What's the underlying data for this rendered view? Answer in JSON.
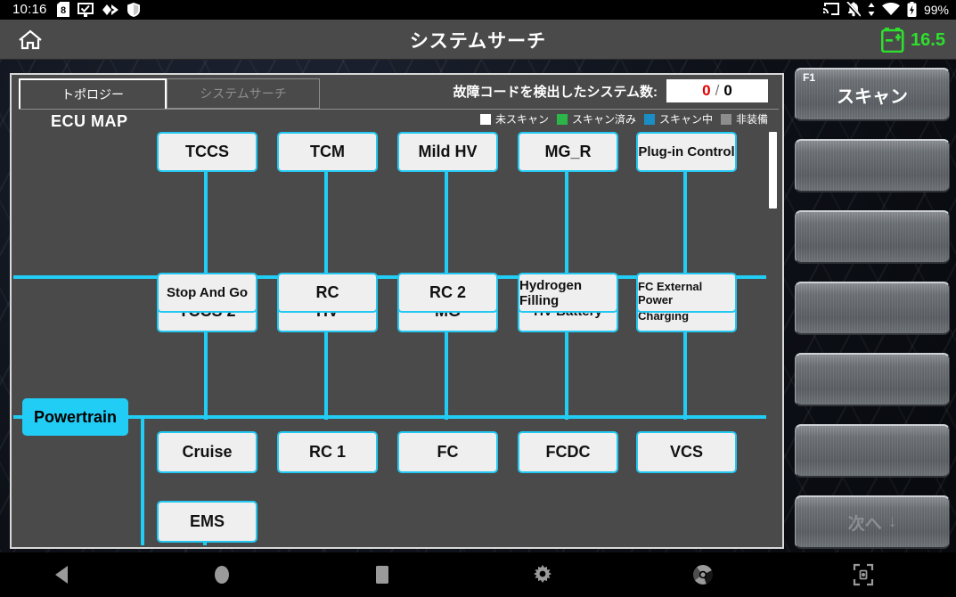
{
  "status_bar": {
    "time": "10:16",
    "battery_percent": "99%",
    "left_icons": [
      "sim-card-icon",
      "display-check-icon",
      "diamond-arrow-icon",
      "shield-icon"
    ],
    "right_icons": [
      "cast-icon",
      "notifications-off-icon",
      "vpn-arrows-icon",
      "wifi-icon",
      "battery-charging-icon"
    ]
  },
  "title_bar": {
    "home_icon": "home-icon",
    "title": "システムサーチ",
    "battery_icon": "vehicle-battery-icon",
    "voltage": "16.5",
    "voltage_color": "#2ee02e"
  },
  "content": {
    "tabs": [
      {
        "label": "トポロジー",
        "active": true
      },
      {
        "label": "システムサーチ",
        "active": false
      }
    ],
    "map_title": "ECU MAP",
    "fault_count": {
      "label": "故障コードを検出したシステム数:",
      "detected": "0",
      "separator": "/",
      "total": "0"
    },
    "legend": [
      {
        "label": "未スキャン",
        "color": "#ffffff"
      },
      {
        "label": "スキャン済み",
        "color": "#2cb64a"
      },
      {
        "label": "スキャン中",
        "color": "#1a8ec4"
      },
      {
        "label": "非装備",
        "color": "#8d8d8d"
      }
    ],
    "root_node": {
      "label": "Powertrain",
      "color": "#22cdf5"
    },
    "node_border_color": "#23c8f2",
    "node_rows": [
      {
        "nodes": [
          {
            "label": "TCCS",
            "size": "lg"
          },
          {
            "label": "TCM",
            "size": "lg"
          },
          {
            "label": "Mild HV",
            "size": "lg"
          },
          {
            "label": "MG_R",
            "size": "lg"
          },
          {
            "label": "Plug-in Control",
            "size": "md"
          }
        ]
      },
      {
        "nodes": [
          {
            "label": "TCCS 2",
            "size": "lg"
          },
          {
            "label": "HV",
            "size": "lg"
          },
          {
            "label": "MG",
            "size": "lg"
          },
          {
            "label": "HV Battery",
            "size": "md"
          },
          {
            "label": "DC Quick Charging",
            "size": "sm"
          }
        ]
      },
      {
        "nodes": [
          {
            "label": "Stop And Go",
            "size": "md"
          },
          {
            "label": "RC",
            "size": "lg"
          },
          {
            "label": "RC 2",
            "size": "lg"
          },
          {
            "label": "Hydrogen Filling",
            "size": "md"
          },
          {
            "label": "FC External Power",
            "size": "sm"
          }
        ]
      },
      {
        "nodes": [
          {
            "label": "Cruise",
            "size": "lg"
          },
          {
            "label": "RC 1",
            "size": "lg"
          },
          {
            "label": "FC",
            "size": "lg"
          },
          {
            "label": "FCDC",
            "size": "lg"
          },
          {
            "label": "VCS",
            "size": "lg"
          }
        ]
      },
      {
        "nodes": [
          {
            "label": "EMS",
            "size": "lg"
          }
        ]
      }
    ]
  },
  "function_keys": [
    {
      "tag": "F1",
      "label": "スキャン",
      "enabled": true
    },
    {
      "tag": "",
      "label": "",
      "enabled": true
    },
    {
      "tag": "",
      "label": "",
      "enabled": true
    },
    {
      "tag": "",
      "label": "",
      "enabled": true
    },
    {
      "tag": "",
      "label": "",
      "enabled": true
    },
    {
      "tag": "",
      "label": "",
      "enabled": true
    },
    {
      "tag": "",
      "label": "次へ",
      "enabled": false,
      "arrow": "↓"
    }
  ],
  "nav_bar": {
    "icons": [
      "back-icon",
      "home-circle-icon",
      "recents-square-icon",
      "settings-gear-icon",
      "chrome-browser-icon",
      "screenshot-icon"
    ]
  }
}
